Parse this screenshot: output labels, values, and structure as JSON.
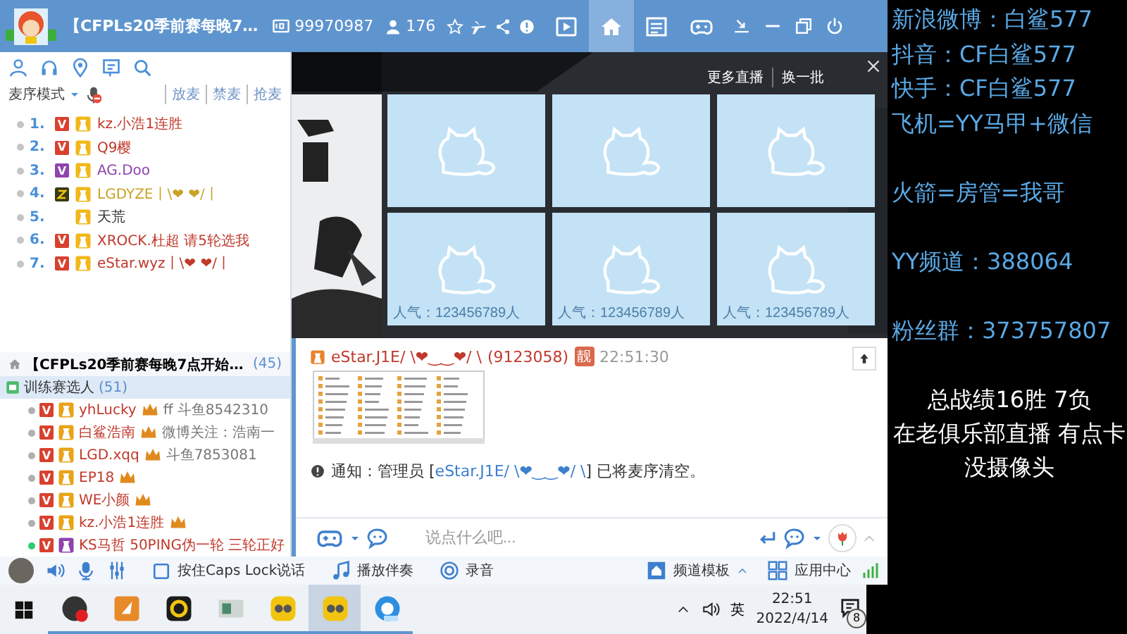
{
  "title_bar": {
    "title": "【CFPLs20季前赛每晚7…",
    "channel_id": "99970987",
    "online_count": "176",
    "tabs": [
      {
        "selected": false
      },
      {
        "selected": true
      },
      {
        "selected": false
      },
      {
        "selected": false
      }
    ]
  },
  "mic_panel": {
    "mode": "麦序模式",
    "actions": [
      "放麦",
      "禁麦",
      "抢麦"
    ],
    "queue": [
      {
        "number": "1.",
        "kind": "vip",
        "badge": "V",
        "name": "kz.小浩1连胜",
        "color": "#c0392b"
      },
      {
        "number": "2.",
        "kind": "vip",
        "badge": "V",
        "name": "Q9樱",
        "color": "#c0392b"
      },
      {
        "number": "3.",
        "kind": "svip",
        "badge": "V",
        "name": "AG.Doo",
        "color": "#8e44ad"
      },
      {
        "number": "4.",
        "kind": "level",
        "name": "LGDYZE丨\\❤  ❤/丨",
        "color": "#c9a227"
      },
      {
        "number": "5.",
        "kind": "none",
        "name": "天荒",
        "color": "#333333"
      },
      {
        "number": "6.",
        "kind": "vip",
        "badge": "V",
        "name": "XROCK.杜超 请5轮选我",
        "color": "#c0392b"
      },
      {
        "number": "7.",
        "kind": "vip",
        "badge": "V",
        "name": "eStar.wyz丨\\❤  ❤/丨",
        "color": "#c0392b"
      }
    ]
  },
  "channel": {
    "name": "【CFPLs20季前赛每晚7点开始…",
    "count": "(45)",
    "subchannel": {
      "name": "训练赛选人",
      "count": "(51)",
      "selected": true
    },
    "members": [
      {
        "color": "#b0b0b0",
        "kind": "member",
        "badge": "V",
        "name": "yhLucky",
        "medal": true,
        "message": "ff 斗鱼8542310"
      },
      {
        "color": "#b0b0b0",
        "kind": "member",
        "badge": "V",
        "name": "白鲨浩南",
        "medal": true,
        "message": "微博关注：浩南一"
      },
      {
        "color": "#b0b0b0",
        "kind": "member",
        "badge": "V",
        "name": "LGD.xqq",
        "medal": true,
        "message": "斗鱼7853081"
      },
      {
        "color": "#b0b0b0",
        "kind": "member",
        "badge": "V",
        "name": "EP18",
        "medal": true
      },
      {
        "color": "#b0b0b0",
        "kind": "member",
        "badge": "V",
        "name": "WE小颜",
        "medal": true
      },
      {
        "color": "#b0b0b0",
        "kind": "member",
        "badge": "V",
        "name": "kz.小浩1连胜",
        "medal": true
      },
      {
        "color": "#2ecc71",
        "kind": "manager",
        "badge": "V",
        "name": "KS马哲 50PING伪一轮 三轮正好",
        "medal": false
      }
    ]
  },
  "recommendations": {
    "actions": [
      "更多直播",
      "换一批"
    ],
    "tiles": [
      {
        "kind": "plain"
      },
      {
        "kind": "plain"
      },
      {
        "kind": "plain"
      },
      {
        "kind": "captioned",
        "caption": "人气：123456789人"
      },
      {
        "kind": "captioned",
        "caption": "人气：123456789人"
      },
      {
        "kind": "captioned",
        "caption": "人气：123456789人"
      }
    ]
  },
  "chat": {
    "messages": [
      {
        "kind": "post",
        "name": "eStar.J1E/ \\❤‿‿❤/ \\",
        "user_id": "(9123058)",
        "badge": "靓",
        "time": "22:51:30"
      },
      {
        "kind": "notice",
        "label": "通知：管理员 [",
        "user": "eStar.J1E/ \\❤‿‿❤/ \\",
        "text": "] 已将麦序清空。"
      }
    ],
    "input": {
      "placeholder": "说点什么吧..."
    }
  },
  "bottom_bar": {
    "items": [
      {
        "kind": "checkbox",
        "label": "按住Caps Lock说话",
        "checked": false
      },
      {
        "kind": "music",
        "label": "播放伴奏"
      },
      {
        "kind": "record",
        "label": "录音"
      },
      {
        "kind": "template",
        "label": "频道模板"
      },
      {
        "kind": "apps",
        "label": "应用中心"
      }
    ]
  },
  "taskbar": {
    "apps": [
      {
        "selected": false
      },
      {
        "selected": false
      },
      {
        "selected": false
      },
      {
        "selected": false
      },
      {
        "selected": false
      },
      {
        "selected": true
      },
      {
        "selected": false
      }
    ],
    "ime": "英",
    "time": "22:51",
    "date": "2022/4/14",
    "notifications": "8"
  },
  "overlay": {
    "info_groups": [
      [
        "新浪微博：白鲨577",
        "抖音：CF白鲨577",
        "快手：CF白鲨577",
        "飞机=YY马甲+微信"
      ],
      [
        "火箭=房管=我哥"
      ],
      [
        "YY频道：388064"
      ],
      [
        "粉丝群：373757807"
      ]
    ],
    "status_lines": [
      "总战绩16胜 7负",
      "在老俱乐部直播 有点卡",
      "没摄像头"
    ]
  }
}
